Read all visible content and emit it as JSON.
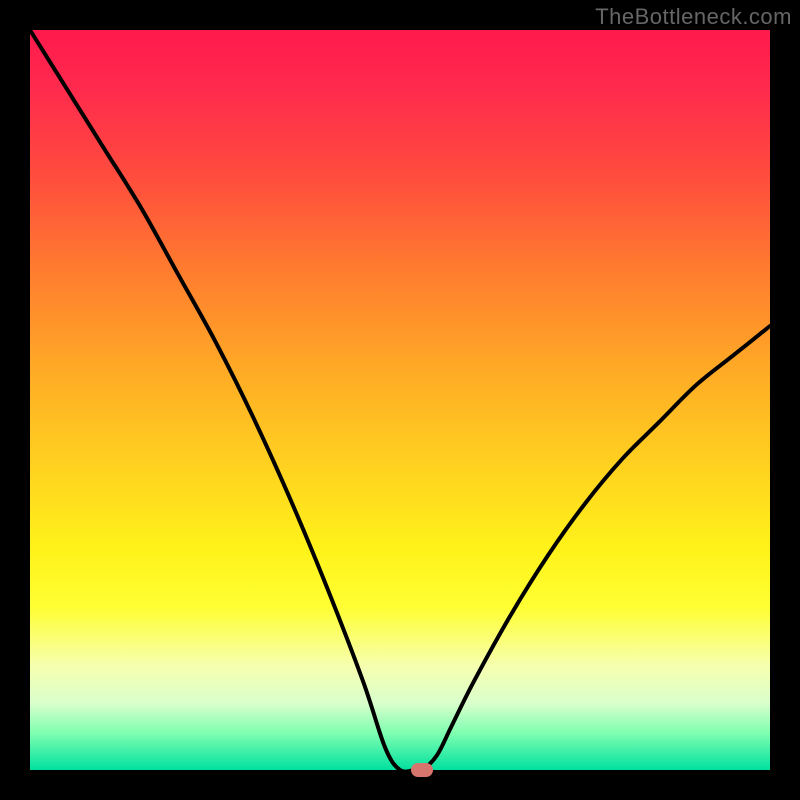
{
  "watermark": "TheBottleneck.com",
  "chart_data": {
    "type": "line",
    "title": "",
    "xlabel": "",
    "ylabel": "",
    "xlim": [
      0,
      100
    ],
    "ylim": [
      0,
      100
    ],
    "grid": false,
    "legend": false,
    "background": "rainbow-vertical-gradient",
    "series": [
      {
        "name": "bottleneck-curve",
        "x": [
          0,
          5,
          10,
          15,
          20,
          25,
          30,
          35,
          40,
          45,
          48,
          50,
          52,
          53,
          55,
          57,
          60,
          65,
          70,
          75,
          80,
          85,
          90,
          95,
          100
        ],
        "y": [
          100,
          92,
          84,
          76,
          67,
          58,
          48,
          37,
          25,
          12,
          3,
          0,
          0,
          0,
          2,
          6,
          12,
          21,
          29,
          36,
          42,
          47,
          52,
          56,
          60
        ]
      }
    ],
    "marker": {
      "x": 53,
      "y": 0,
      "color": "#d6746e"
    },
    "gradient_stops": [
      {
        "pos": 0.0,
        "color": "#ff1a4d"
      },
      {
        "pos": 0.2,
        "color": "#ff4d3d"
      },
      {
        "pos": 0.45,
        "color": "#ffa726"
      },
      {
        "pos": 0.7,
        "color": "#fff21a"
      },
      {
        "pos": 0.86,
        "color": "#f6ffb0"
      },
      {
        "pos": 0.95,
        "color": "#7fffb0"
      },
      {
        "pos": 1.0,
        "color": "#00e0a0"
      }
    ]
  }
}
